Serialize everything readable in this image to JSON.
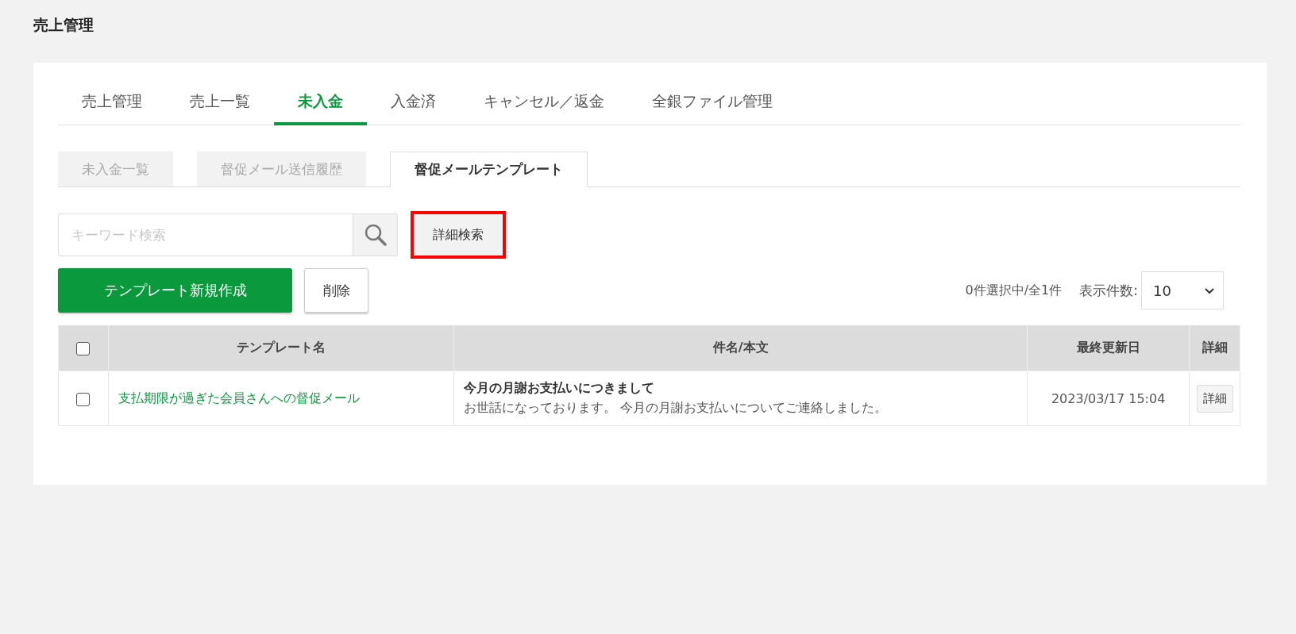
{
  "page_title": "売上管理",
  "tabs": [
    {
      "label": "売上管理",
      "selected": false
    },
    {
      "label": "売上一覧",
      "selected": false
    },
    {
      "label": "未入金",
      "selected": true
    },
    {
      "label": "入金済",
      "selected": false
    },
    {
      "label": "キャンセル／返金",
      "selected": false
    },
    {
      "label": "全銀ファイル管理",
      "selected": false
    }
  ],
  "sub_tabs": [
    {
      "label": "未入金一覧",
      "selected": false
    },
    {
      "label": "督促メール送信履歴",
      "selected": false
    },
    {
      "label": "督促メールテンプレート",
      "selected": true
    }
  ],
  "search": {
    "placeholder": "キーワード検索",
    "advanced_button": {
      "label": "詳細検索",
      "highlighted": true
    }
  },
  "actions": {
    "create_button": "テンプレート新規作成",
    "delete_button": "削除"
  },
  "selection_count": "0件選択中/全1件",
  "page_size": {
    "label": "表示件数:",
    "value": "10"
  },
  "table": {
    "select_all_checked": false,
    "columns": [
      "テンプレート名",
      "件名/本文",
      "最終更新日",
      "詳細"
    ],
    "rows": [
      {
        "checked": false,
        "name": "支払期限が過ぎた会員さんへの督促メール",
        "subject": "今月の月謝お支払いにつきまして",
        "body": "お世話になっております。 今月の月謝お支払いについてご連絡しました。",
        "updated": "2023/03/17 15:04",
        "detail_button": "詳細"
      }
    ]
  }
}
